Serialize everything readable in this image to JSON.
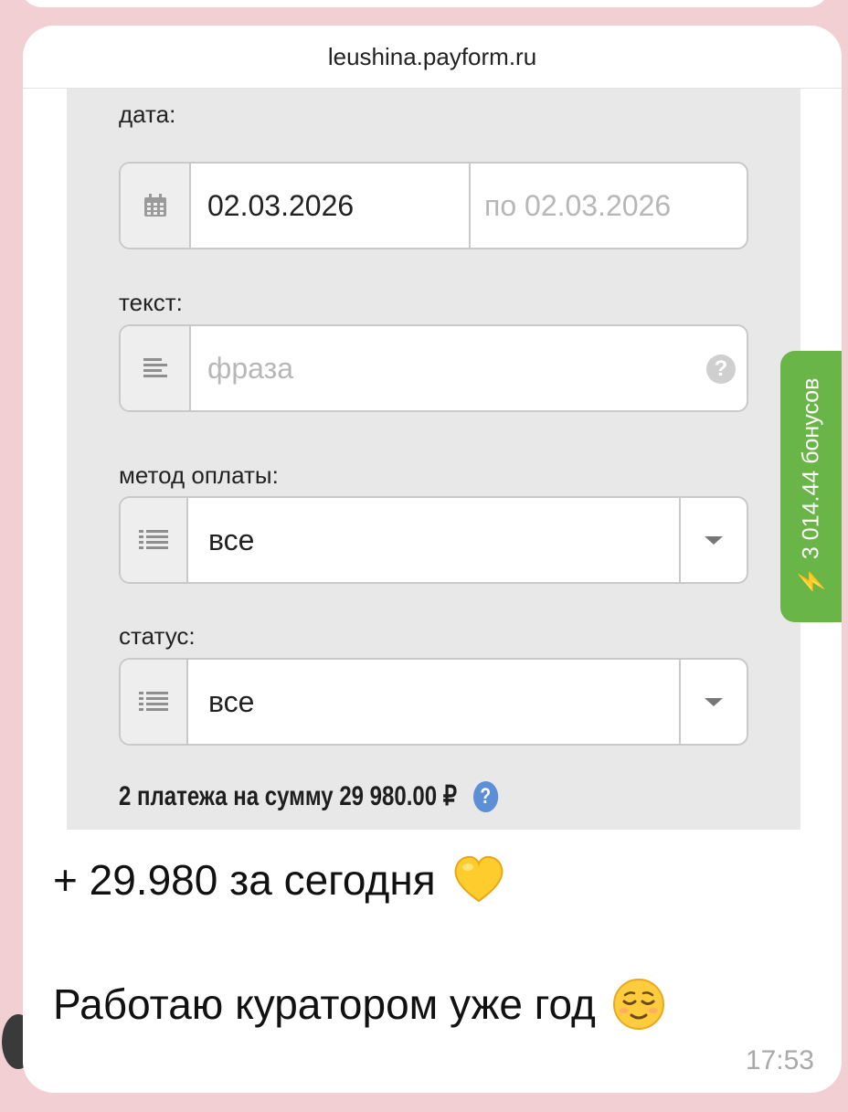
{
  "site": {
    "domain": "leushina.payform.ru"
  },
  "filters": {
    "date": {
      "label": "дата:",
      "icon": "calendar-icon",
      "from_value": "02.03.2026",
      "to_placeholder": "по 02.03.2026"
    },
    "text": {
      "label": "текст:",
      "icon": "text-lines-icon",
      "placeholder": "фраза",
      "help_glyph": "?"
    },
    "payment_method": {
      "label": "метод оплаты:",
      "icon": "list-icon",
      "value": "все"
    },
    "status": {
      "label": "статус:",
      "icon": "list-icon",
      "value": "все"
    }
  },
  "summary": {
    "text": "2 платежа на сумму 29 980.00 ₽",
    "help_glyph": "?"
  },
  "bonus": {
    "icon": "lightning-icon",
    "glyph": "⚡",
    "text": "3 014.44 бонусов"
  },
  "message": {
    "line1": "+ 29.980 за сегодня",
    "line1_emoji": "yellow-heart-emoji",
    "line2": "Работаю куратором уже год",
    "line2_emoji": "relieved-face-emoji",
    "time": "17:53"
  },
  "colors": {
    "chat_background": "#f2cfd3",
    "bonus_tab": "#6ab548",
    "help_blue": "#5d8fd6",
    "heart": "#ffcc2e"
  }
}
